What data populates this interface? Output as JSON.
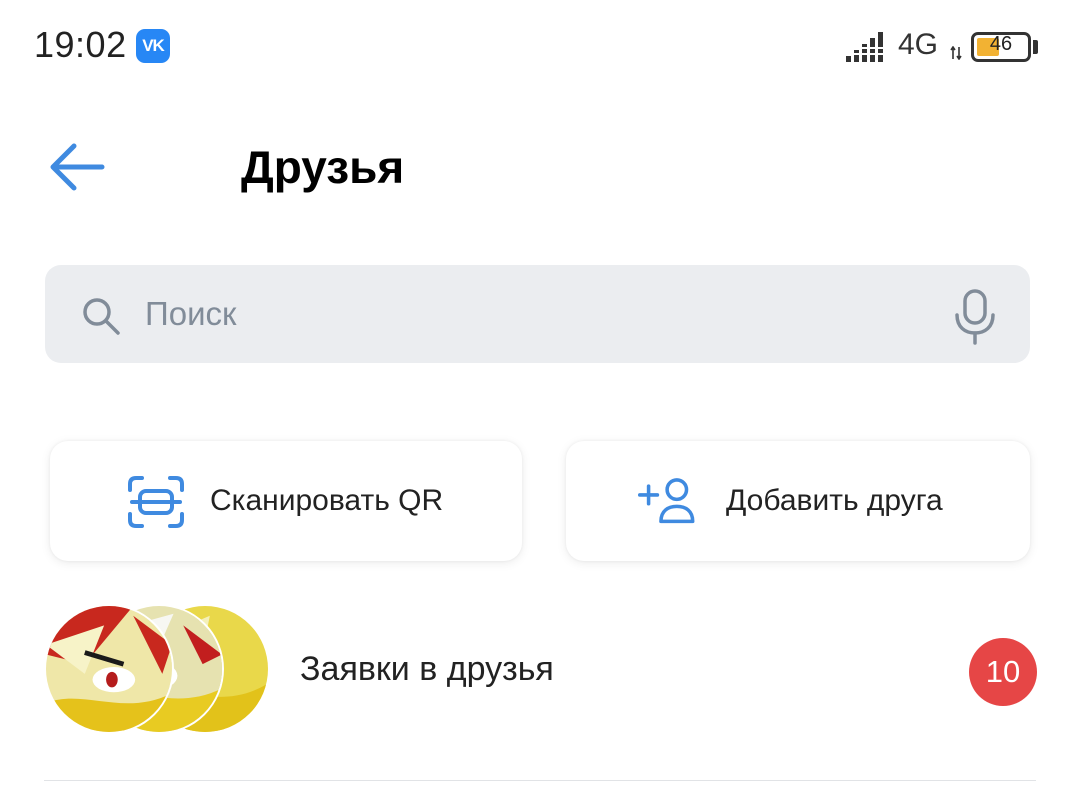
{
  "status_bar": {
    "time": "19:02",
    "app_badge_icon": "vk-logo-icon",
    "app_badge_text": "VK",
    "network_type": "4G",
    "battery_level": "46",
    "battery_fraction": 0.46
  },
  "header": {
    "back_icon": "arrow-left-icon",
    "title": "Друзья"
  },
  "search": {
    "placeholder": "Поиск",
    "value": "",
    "search_icon": "search-icon",
    "mic_icon": "microphone-icon"
  },
  "actions": {
    "scan_qr_label": "Сканировать QR",
    "scan_qr_icon": "qr-scan-icon",
    "add_friend_label": "Добавить друга",
    "add_friend_icon": "add-user-icon"
  },
  "requests": {
    "label": "Заявки в друзья",
    "count": "10"
  },
  "colors": {
    "accent": "#2787f5",
    "icon_blue": "#3f8ae0",
    "badge_red": "#e64646",
    "search_bg": "#ebedf0",
    "placeholder": "#818c99"
  }
}
